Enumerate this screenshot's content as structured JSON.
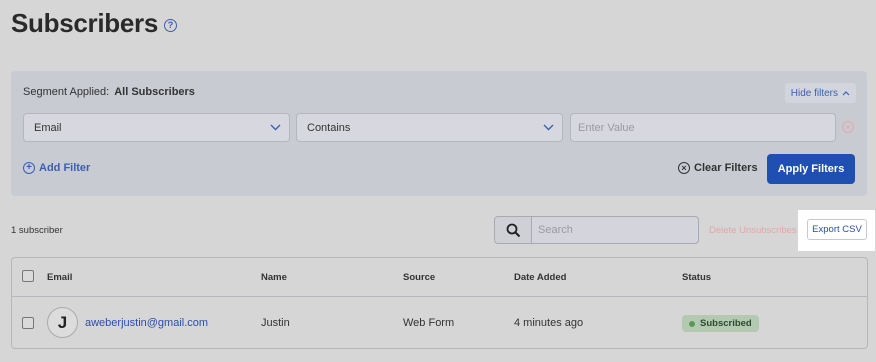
{
  "header": {
    "title": "Subscribers",
    "help_icon": "?"
  },
  "filters": {
    "segment_label": "Segment Applied:",
    "segment_value": "All Subscribers",
    "hide_filters_label": "Hide filters",
    "field_select": "Email",
    "operator_select": "Contains",
    "value_placeholder": "Enter Value",
    "add_filter_label": "Add Filter",
    "clear_filters_label": "Clear Filters",
    "apply_label": "Apply Filters"
  },
  "toolbar": {
    "count_text": "1 subscriber",
    "search_placeholder": "Search",
    "delete_unsub_label": "Delete Unsubscribes",
    "export_label": "Export CSV"
  },
  "table": {
    "columns": [
      "Email",
      "Name",
      "Source",
      "Date Added",
      "Status"
    ],
    "rows": [
      {
        "avatar": "J",
        "email": "aweberjustin@gmail.com",
        "name": "Justin",
        "source": "Web Form",
        "date_added": "4 minutes ago",
        "status": "Subscribed"
      }
    ]
  },
  "colors": {
    "accent": "#1f4fb0",
    "link": "#2c4ea8",
    "status_subscribed": "#5a9a58"
  }
}
